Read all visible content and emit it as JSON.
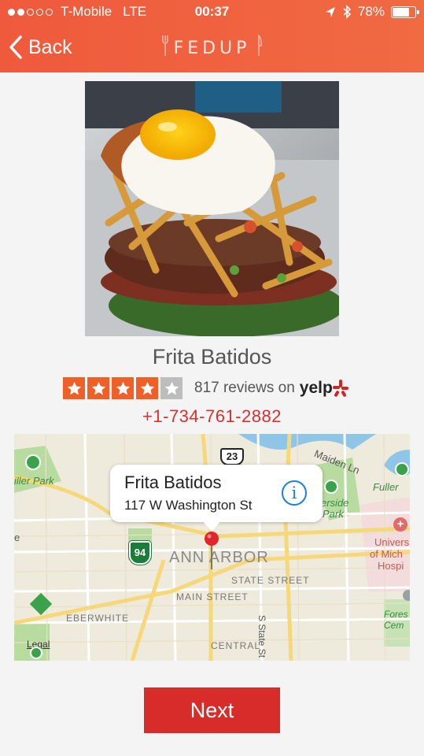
{
  "status_bar": {
    "carrier": "T-Mobile",
    "network": "LTE",
    "time": "00:37",
    "battery_text": "78%",
    "battery_level": 0.78,
    "signal_bars_filled": 2,
    "signal_bars_total": 5
  },
  "nav": {
    "back_label": "Back",
    "logo_text": "FEDUP"
  },
  "restaurant": {
    "name": "Frita Batidos",
    "rating": 4,
    "rating_max": 5,
    "reviews_text": "817 reviews on",
    "yelp_text": "yelp",
    "phone": "+1-734-761-2882"
  },
  "map": {
    "callout_title": "Frita Batidos",
    "callout_subtitle": "117 W Washington St",
    "info_glyph": "i",
    "labels": {
      "miller_park": "iller Park",
      "route_23": "23",
      "maiden_ln": "Maiden Ln",
      "fuller": "Fuller",
      "riverside_park_1": "erside",
      "riverside_park_2": "Park",
      "univ_1": "Univers",
      "univ_2": "of Mich",
      "univ_3": "Hospi",
      "route_94": "94",
      "city": "ANN ARBOR",
      "state_street": "STATE STREET",
      "main_street": "MAIN STREET",
      "s_state_st": "S State St",
      "eberwhite": "EBERWHITE",
      "forest_1": "Fores",
      "forest_2": "Cem",
      "legal": "Legal",
      "central": "CENTRAL",
      "edge_e": "e"
    }
  },
  "footer": {
    "next_label": "Next"
  },
  "colors": {
    "header": "#ef5a3c",
    "star": "#f05f25",
    "star_empty": "#bdbdbd",
    "phone": "#d8312f",
    "next": "#d82c2b",
    "info": "#1e7fe0"
  }
}
